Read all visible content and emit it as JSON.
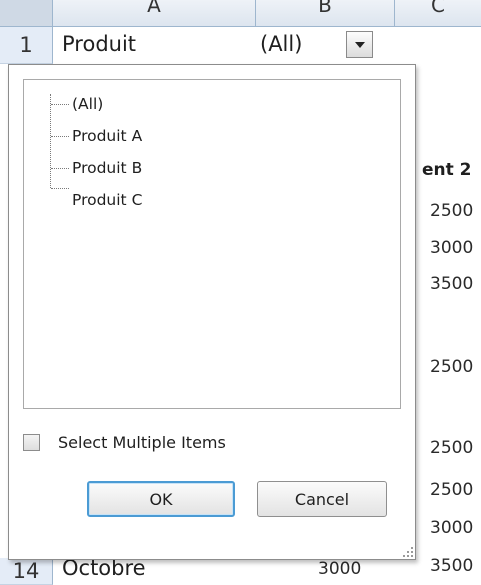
{
  "sheet": {
    "columns": [
      "A",
      "B",
      "C"
    ],
    "row1": {
      "row_number": "1",
      "label": "Produit",
      "value": "(All)"
    },
    "right_column": {
      "header_partial": "ent 2",
      "values": [
        "2500",
        "3000",
        "3500",
        "2500",
        "2500",
        "2500",
        "3000",
        "3500"
      ]
    },
    "last_row": {
      "row_number": "14",
      "label": "Octobre",
      "value": "3000"
    }
  },
  "filter_panel": {
    "items": [
      "(All)",
      "Produit A",
      "Produit B",
      "Produit C"
    ],
    "select_multiple_label": "Select Multiple Items",
    "select_multiple_checked": false,
    "ok_label": "OK",
    "cancel_label": "Cancel"
  }
}
